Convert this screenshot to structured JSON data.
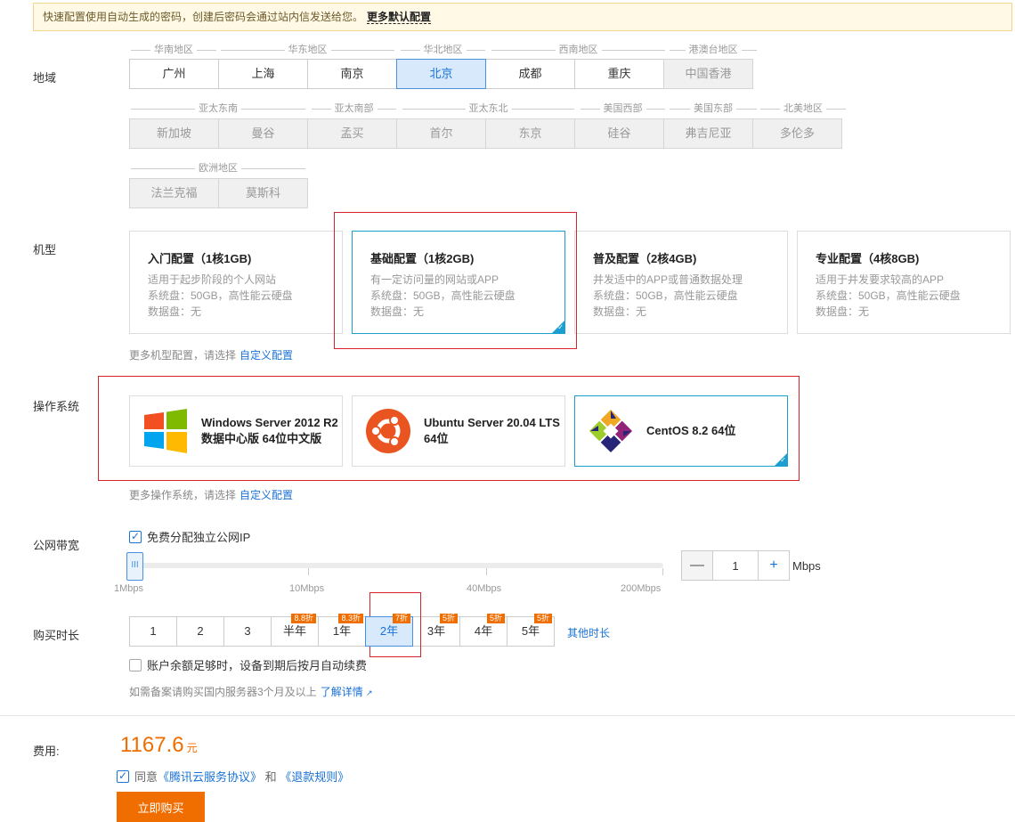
{
  "notice": {
    "text": "快速配置使用自动生成的密码，创建后密码会通过站内信发送给您。",
    "more": "更多默认配置"
  },
  "region": {
    "label": "地域",
    "row1_groups": [
      "华南地区",
      "华东地区",
      "华北地区",
      "西南地区",
      "港澳台地区"
    ],
    "row1": [
      "广州",
      "上海",
      "南京",
      "北京",
      "成都",
      "重庆",
      "中国香港"
    ],
    "row2_groups": [
      "亚太东南",
      "亚太南部",
      "亚太东北",
      "美国西部",
      "美国东部",
      "北美地区"
    ],
    "row2": [
      "新加坡",
      "曼谷",
      "孟买",
      "首尔",
      "东京",
      "硅谷",
      "弗吉尼亚",
      "多伦多"
    ],
    "row3_groups": [
      "欧洲地区"
    ],
    "row3": [
      "法兰克福",
      "莫斯科"
    ]
  },
  "model": {
    "label": "机型",
    "cards": [
      {
        "title": "入门配置（1核1GB)",
        "desc": "适用于起步阶段的个人网站",
        "sys": "系统盘：50GB，高性能云硬盘",
        "data": "数据盘：无"
      },
      {
        "title": "基础配置（1核2GB)",
        "desc": "有一定访问量的网站或APP",
        "sys": "系统盘：50GB，高性能云硬盘",
        "data": "数据盘：无"
      },
      {
        "title": "普及配置（2核4GB)",
        "desc": "并发适中的APP或普通数据处理",
        "sys": "系统盘：50GB，高性能云硬盘",
        "data": "数据盘：无"
      },
      {
        "title": "专业配置（4核8GB)",
        "desc": "适用于并发要求较高的APP",
        "sys": "系统盘：50GB，高性能云硬盘",
        "data": "数据盘：无"
      }
    ],
    "hint": "更多机型配置，请选择",
    "hint_link": "自定义配置"
  },
  "os": {
    "label": "操作系统",
    "cards": [
      {
        "name": "Windows Server 2012 R2 数据中心版 64位中文版",
        "icon": "windows-logo-icon"
      },
      {
        "name": "Ubuntu Server 20.04 LTS 64位",
        "icon": "ubuntu-logo-icon"
      },
      {
        "name": "CentOS 8.2 64位",
        "icon": "centos-logo-icon"
      }
    ],
    "hint": "更多操作系统，请选择",
    "hint_link": "自定义配置"
  },
  "bandwidth": {
    "label": "公网带宽",
    "checkbox": "免费分配独立公网IP",
    "ticks": [
      "1Mbps",
      "10Mbps",
      "40Mbps",
      "200Mbps"
    ],
    "handle": "III",
    "value": "1",
    "minus": "—",
    "plus": "+",
    "unit": "Mbps"
  },
  "duration": {
    "label": "购买时长",
    "options": [
      {
        "label": "1",
        "badge": ""
      },
      {
        "label": "2",
        "badge": ""
      },
      {
        "label": "3",
        "badge": ""
      },
      {
        "label": "半年",
        "badge": "8.8折"
      },
      {
        "label": "1年",
        "badge": "8.3折"
      },
      {
        "label": "2年",
        "badge": "7折"
      },
      {
        "label": "3年",
        "badge": "5折"
      },
      {
        "label": "4年",
        "badge": "5折"
      },
      {
        "label": "5年",
        "badge": "5折"
      }
    ],
    "other": "其他时长",
    "autorenew": "账户余额足够时，设备到期后按月自动续费",
    "filing_hint": "如需备案请购买国内服务器3个月及以上",
    "filing_link": "了解详情"
  },
  "cost": {
    "label": "费用:",
    "amount": "1167.6",
    "currency": "元",
    "agree_prefix": "同意",
    "agree_link1": "《腾讯云服务协议》",
    "agree_mid": "和",
    "agree_link2": "《退款规则》",
    "buy": "立即购买"
  },
  "colors": {
    "accent": "#1a72d6",
    "orange": "#f06d00",
    "highlight": "#d9232b"
  }
}
